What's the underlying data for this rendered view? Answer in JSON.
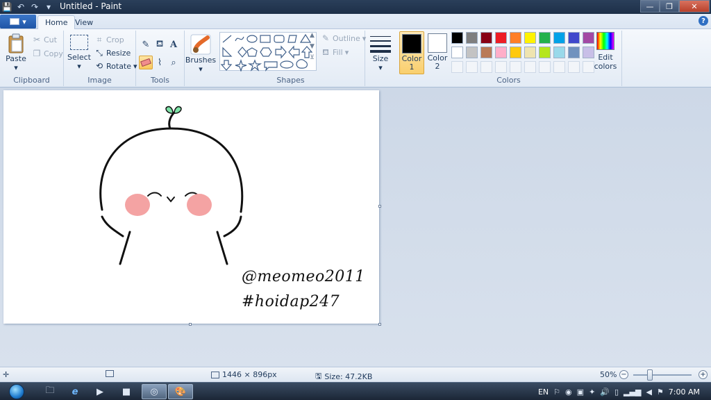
{
  "window": {
    "title": "Untitled - Paint",
    "minimize": "—",
    "maximize": "❐",
    "close": "✕"
  },
  "quick_access": {
    "save_icon": "💾",
    "undo_icon": "↶",
    "redo_icon": "↷",
    "dropdown_icon": "▾"
  },
  "tabs": [
    {
      "label": "Home"
    },
    {
      "label": "View"
    }
  ],
  "help": "?",
  "ribbon": {
    "clipboard": {
      "label": "Clipboard",
      "paste": "Paste",
      "cut": "Cut",
      "copy": "Copy"
    },
    "image": {
      "label": "Image",
      "select": "Select",
      "crop": "Crop",
      "resize": "Resize",
      "rotate": "Rotate"
    },
    "tools": {
      "label": "Tools"
    },
    "brushes": {
      "label": "Brushes"
    },
    "shapes": {
      "label": "Shapes",
      "outline": "Outline",
      "fill": "Fill"
    },
    "size": {
      "label": "Size"
    },
    "colors": {
      "label": "Colors",
      "color1": {
        "label": "Color",
        "num": "1",
        "value": "#000000"
      },
      "color2": {
        "label": "Color",
        "num": "2",
        "value": "#ffffff"
      },
      "edit": {
        "line1": "Edit",
        "line2": "colors"
      },
      "palette_row1": [
        "#000000",
        "#7f7f7f",
        "#880015",
        "#ed1c24",
        "#ff7f27",
        "#fff200",
        "#22b14c",
        "#00a2e8",
        "#3f48cc",
        "#a349a4"
      ],
      "palette_row2": [
        "#ffffff",
        "#c3c3c3",
        "#b97a57",
        "#ffaec9",
        "#ffc90e",
        "#efe4b0",
        "#b5e61d",
        "#99d9ea",
        "#7092be",
        "#c8bfe7"
      ]
    }
  },
  "canvas": {
    "text_line1": "@meomeo2011",
    "text_line2": "#hoidap247",
    "blush_color": "#f4a3a3",
    "sprout_color": "#7de3a7"
  },
  "status": {
    "dimensions": "1446 × 896px",
    "size": "Size: 47.2KB",
    "zoom": "50%"
  },
  "taskbar": {
    "language": "EN",
    "time": "7:00 AM"
  }
}
